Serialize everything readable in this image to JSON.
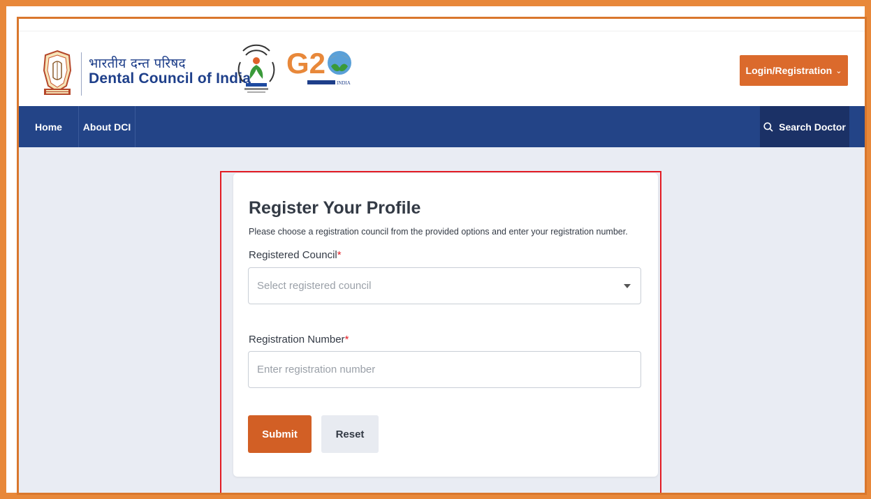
{
  "header": {
    "brand_hindi": "भारतीय दन्त परिषद",
    "brand_english": "Dental Council of India",
    "login_label": "Login/Registration",
    "login_chevron": "⌄"
  },
  "nav": {
    "items": [
      {
        "label": "Home"
      },
      {
        "label": "About DCI"
      }
    ],
    "search_label": "Search Doctor"
  },
  "form": {
    "title": "Register Your Profile",
    "description": "Please choose a registration council from the provided options and enter your registration number.",
    "council_label": "Registered Council",
    "council_placeholder": "Select registered council",
    "number_label": "Registration Number",
    "number_placeholder": "Enter registration number",
    "required_mark": "*",
    "submit_label": "Submit",
    "reset_label": "Reset"
  },
  "colors": {
    "frame_outer": "#e8883a",
    "navbar": "#234487",
    "search_bg": "#1b3166",
    "brand_text": "#1e3f8a",
    "primary_button": "#d25f25",
    "login_button": "#db6a2c",
    "highlight": "#e31b23",
    "page_bg": "#e9ecf3"
  },
  "icons": {
    "emblem": "dci-emblem-icon",
    "digital_mission": "digital-mission-logo-icon",
    "g20": "g20-logo-icon",
    "search": "search-icon",
    "dropdown": "caret-down-icon"
  }
}
